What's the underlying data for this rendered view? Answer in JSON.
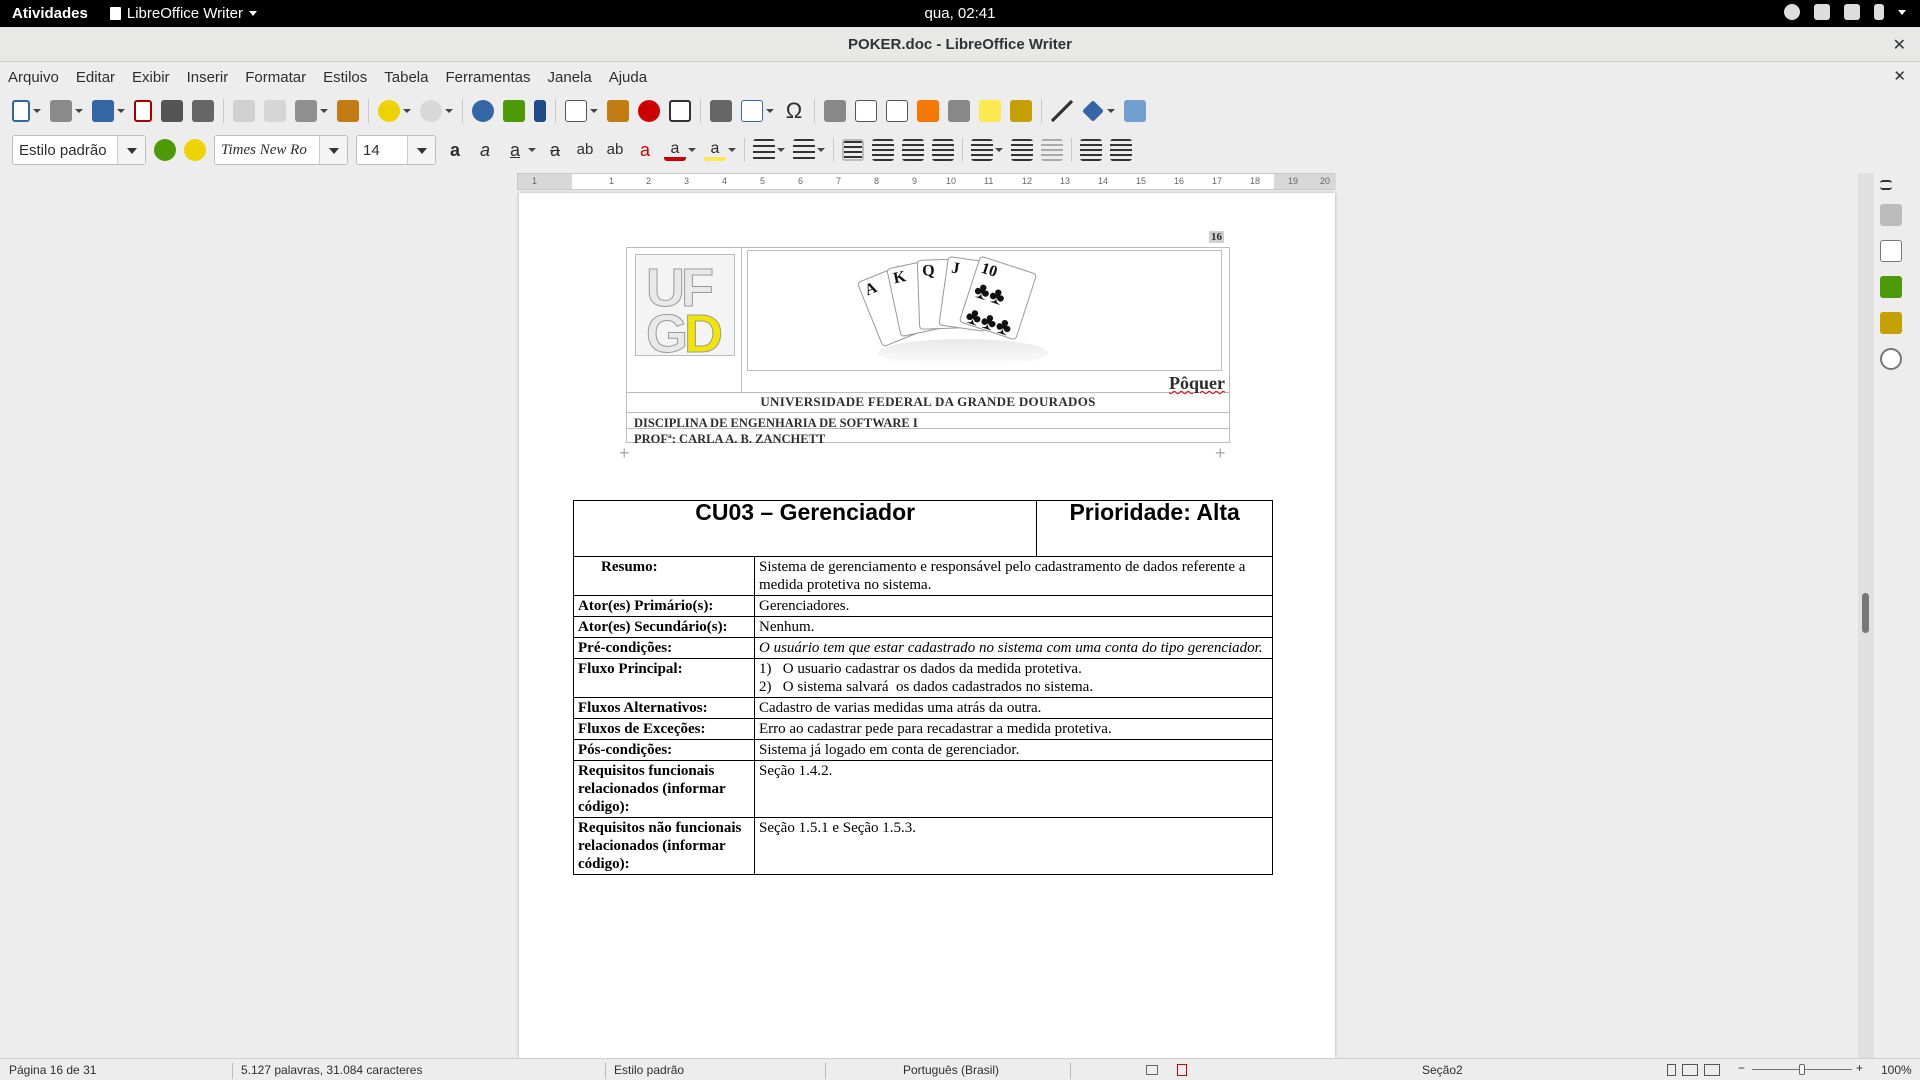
{
  "topbar": {
    "activities": "Atividades",
    "app_name": "LibreOffice Writer",
    "clock": "qua, 02:41"
  },
  "window": {
    "title": "POKER.doc - LibreOffice Writer"
  },
  "menu": [
    "Arquivo",
    "Editar",
    "Exibir",
    "Inserir",
    "Formatar",
    "Estilos",
    "Tabela",
    "Ferramentas",
    "Janela",
    "Ajuda"
  ],
  "formatting": {
    "para_style": "Estilo padrão",
    "font_name": "Times New Ro",
    "font_size": "14"
  },
  "ruler": {
    "numbers": [
      "1",
      "1",
      "2",
      "3",
      "4",
      "5",
      "6",
      "7",
      "8",
      "9",
      "10",
      "11",
      "12",
      "13",
      "14",
      "15",
      "16",
      "17",
      "18",
      "19",
      "20"
    ]
  },
  "document": {
    "page_number": "16",
    "header": {
      "logo_line1": "UF",
      "logo_line2_a": "G",
      "logo_line2_b": "D",
      "title": "Pôquer",
      "university": "UNIVERSIDADE FEDERAL DA GRANDE DOURADOS",
      "discipline": "DISCIPLINA DE ENGENHARIA DE SOFTWARE I",
      "professor": "PROFª: CARLA A. B. ZANCHETT"
    },
    "cards": [
      "A",
      "K",
      "Q",
      "J",
      "10"
    ],
    "use_case": {
      "title": "CU03 – Gerenciador",
      "priority": "Prioridade: Alta",
      "rows": {
        "resumo": {
          "label": "Resumo:",
          "value": "Sistema de gerenciamento e responsável pelo cadastramento de dados referente a medida protetiva no sistema."
        },
        "ator_primario": {
          "label": "Ator(es) Primário(s):",
          "value": "Gerenciadores."
        },
        "ator_secundario": {
          "label": "Ator(es) Secundário(s):",
          "value": "Nenhum."
        },
        "pre_condicoes": {
          "label": "Pré-condições:",
          "value": "O usuário tem que estar cadastrado no sistema com uma conta do tipo gerenciador."
        },
        "fluxo_principal": {
          "label": "Fluxo Principal:",
          "step1": "1)   O usuario cadastrar os dados da medida protetiva.",
          "step2": "2)   O sistema salvará  os dados cadastrados no sistema."
        },
        "fluxos_alternativos": {
          "label": "Fluxos Alternativos:",
          "value": "Cadastro de varias medidas uma atrás da outra."
        },
        "fluxos_excecoes": {
          "label": "Fluxos de Exceções:",
          "value": "Erro ao cadastrar pede para recadastrar a medida protetiva."
        },
        "pos_condicoes": {
          "label": "Pós-condições:",
          "value": "Sistema já logado em conta de gerenciador."
        },
        "req_funcionais": {
          "label": "Requisitos funcionais relacionados (informar código):",
          "value": "Seção 1.4.2."
        },
        "req_nao_funcionais": {
          "label": "Requisitos não funcionais relacionados (informar código):",
          "value": "Seção 1.5.1 e Seção 1.5.3."
        }
      }
    }
  },
  "statusbar": {
    "page": "Página 16 de 31",
    "words": "5.127 palavras, 31.084 caracteres",
    "style": "Estilo padrão",
    "language": "Português (Brasil)",
    "section": "Seção2",
    "zoom": "100%"
  },
  "colors": {
    "accent_blue": "#3465a4",
    "logo_yellow": "#f2e600",
    "spell_red": "#d00000"
  }
}
